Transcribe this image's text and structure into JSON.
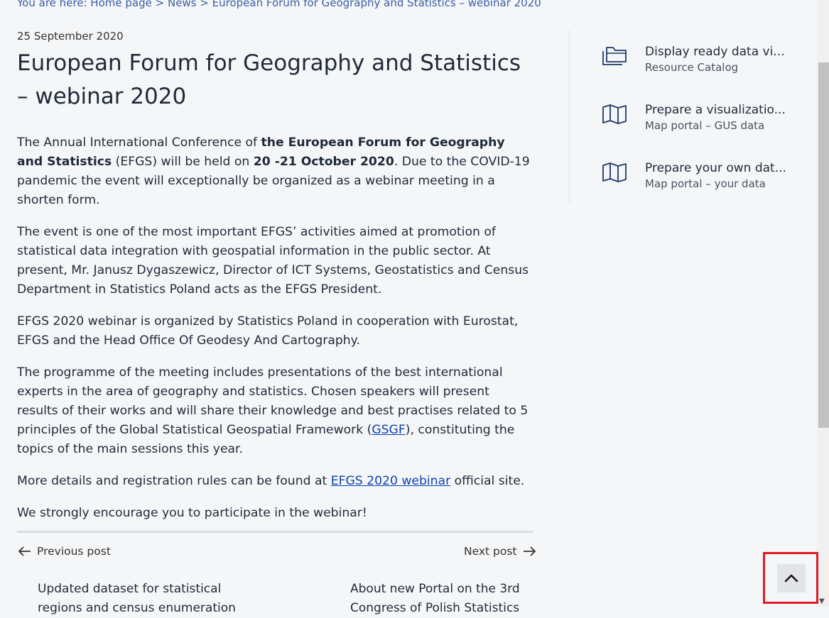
{
  "breadcrumb": {
    "prefix": "You are here:",
    "home": "Home page",
    "sep": ">",
    "news": "News",
    "current": "European Forum for Geography and Statistics – webinar 2020"
  },
  "article": {
    "date": "25 September 2020",
    "title": "European Forum for Geography and Statistics – webinar 2020",
    "p1": {
      "t1": "The Annual International Conference of ",
      "b1": "the European Forum for Geography and Statistics",
      "t2": " (EFGS) will be held on ",
      "b2": "20 -21 October 2020",
      "t3": ". Due to the COVID-19 pandemic the event will exceptionally be organized as a webinar meeting in a shorten form."
    },
    "p2": "The event is one of the most important EFGS’ activities aimed at promotion of statistical data integration with geospatial information in the public sector. At present, Mr. Janusz Dygaszewicz, Director of ICT Systems, Geostatistics and Census Department in Statistics Poland acts as the EFGS President.",
    "p3": "EFGS 2020 webinar is organized by Statistics Poland in cooperation with Eurostat, EFGS and the Head Office Of Geodesy And Cartography.",
    "p4": {
      "t1": "The programme of the meeting includes presentations of the best international experts in the area of  geography and statistics. Chosen speakers will present results of their works and will share their knowledge and best practises related to 5 principles of the Global Statistical Geospatial Framework (",
      "link": "GSGF",
      "t2": "), constituting the topics of the main sessions this year."
    },
    "p5": {
      "t1": "More details and registration rules can be found at ",
      "link": "EFGS 2020 webinar",
      "t2": " official site."
    },
    "p6": "We strongly encourage you to participate in the webinar!"
  },
  "post_nav": {
    "prev_label": "Previous post",
    "next_label": "Next post",
    "prev_title": "Updated dataset for statistical regions and census enumeration",
    "next_title": "About new Portal on the 3rd Congress of Polish Statistics"
  },
  "sidebar": {
    "items": [
      {
        "title": "Display ready data vi...",
        "subtitle": "Resource Catalog",
        "icon": "folders-icon"
      },
      {
        "title": "Prepare a visualizatio...",
        "subtitle": "Map portal – GUS data",
        "icon": "map-icon"
      },
      {
        "title": "Prepare your own dat...",
        "subtitle": "Map portal – your data",
        "icon": "map-icon"
      }
    ]
  },
  "colors": {
    "accent_link": "#0b43b2",
    "breadcrumb": "#3b5fa6",
    "highlight_frame": "#e01b24"
  }
}
